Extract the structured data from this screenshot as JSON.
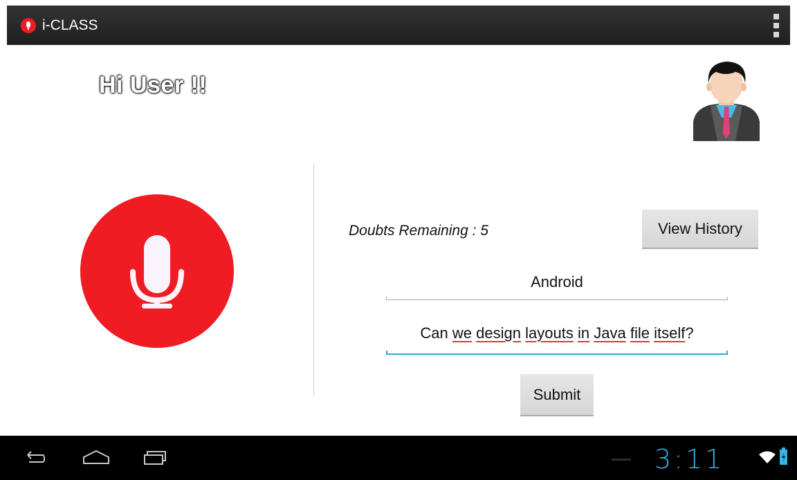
{
  "app": {
    "title": "i-CLASS",
    "icon": "mic-icon",
    "accent": "#ee1c25"
  },
  "greeting": {
    "text": "Hi User !!"
  },
  "profile": {
    "icon": "user-avatar-icon"
  },
  "doubts": {
    "label": "Doubts Remaining : 5"
  },
  "buttons": {
    "history": "View History",
    "submit": "Submit"
  },
  "form": {
    "subject": "Android",
    "question_words": [
      "Can",
      "we",
      "design",
      "layouts",
      "in",
      "Java",
      "file",
      "itself"
    ],
    "question_suffix": "?"
  },
  "status": {
    "time": "3:11",
    "wifi_icon": "wifi-icon",
    "battery_icon": "battery-charging-icon",
    "clock_color": "#33b5e5"
  },
  "nav": {
    "back_icon": "back-icon",
    "home_icon": "home-icon",
    "recents_icon": "recents-icon"
  }
}
